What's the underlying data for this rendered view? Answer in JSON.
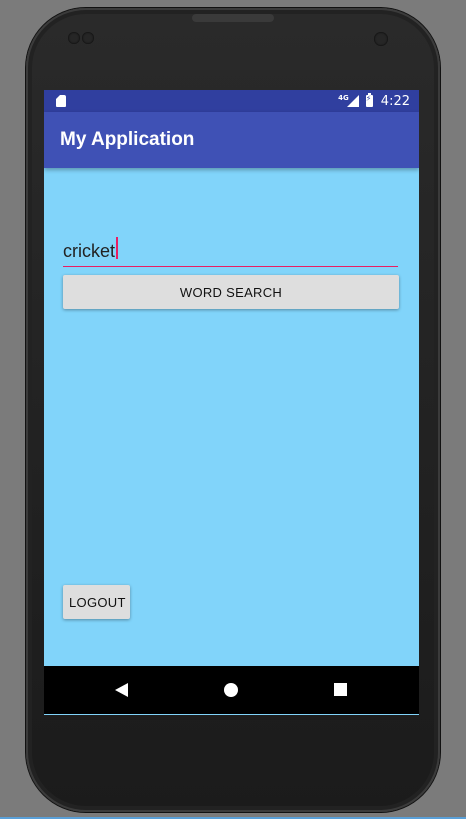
{
  "statusbar": {
    "network": "4G",
    "time": "4:22"
  },
  "appbar": {
    "title": "My Application"
  },
  "main": {
    "word_input_value": "cricket",
    "search_button_label": "WORD SEARCH",
    "logout_button_label": "LOGOUT"
  },
  "navigation": {
    "icons": [
      "back-icon",
      "home-icon",
      "recents-icon"
    ]
  },
  "colors": {
    "statusbar": "#303f9f",
    "appbar": "#3f51b5",
    "content_background": "#81d4fa",
    "input_underline": "#e91e63",
    "button": "#dedede"
  }
}
